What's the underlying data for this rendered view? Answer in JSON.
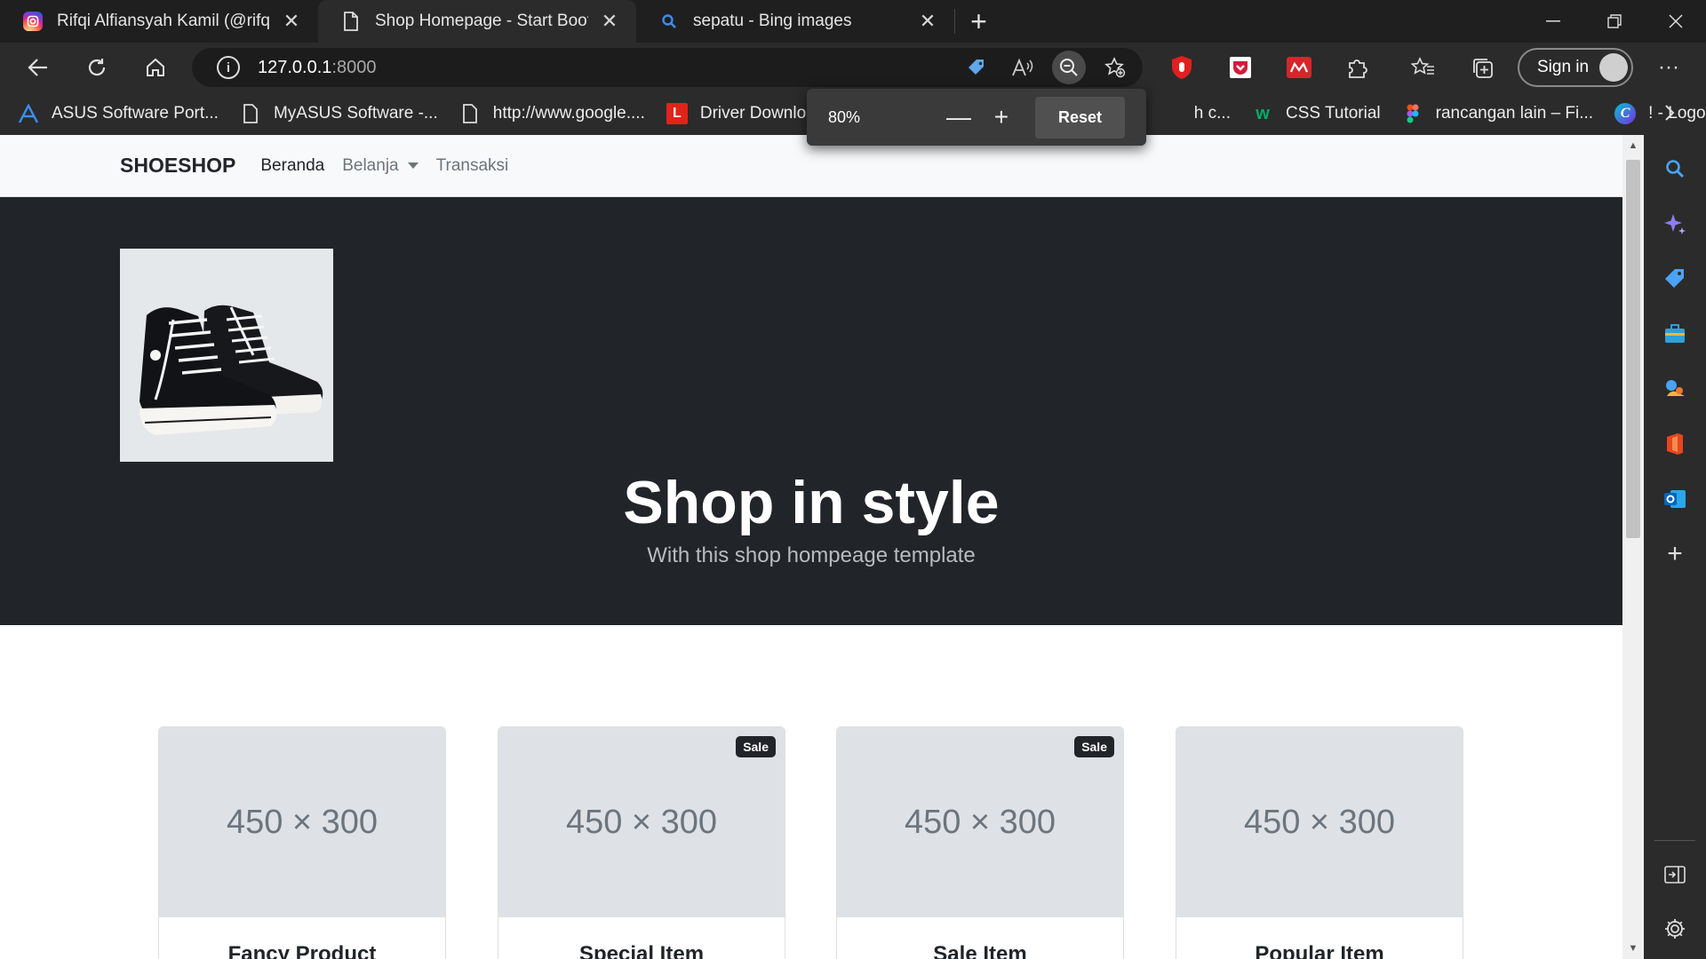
{
  "tabs": [
    {
      "title": "Rifqi Alfiansyah Kamil (@rifqii.ak",
      "close": "✕",
      "icon": "instagram-icon"
    },
    {
      "title": "Shop Homepage - Start Bootstra",
      "close": "✕",
      "icon": "page-icon"
    },
    {
      "title": "sepatu - Bing images",
      "close": "✕",
      "icon": "search-icon"
    }
  ],
  "address": {
    "host": "127.0.0.1",
    "port": ":8000"
  },
  "signin_label": "Sign in",
  "bookmarks": [
    {
      "label": "ASUS Software Port...",
      "icon": "asus-icon"
    },
    {
      "label": "MyASUS Software -...",
      "icon": "page-icon"
    },
    {
      "label": "http://www.google....",
      "icon": "page-icon"
    },
    {
      "label": "Driver Downloads",
      "icon": "lenovo-icon"
    },
    {
      "label": "h c...",
      "icon": ""
    },
    {
      "label": "CSS Tutorial",
      "icon": "w3schools-icon"
    },
    {
      "label": "rancangan lain – Fi...",
      "icon": "figma-icon"
    },
    {
      "label": "! - Logo",
      "icon": "canva-icon"
    }
  ],
  "zoom": {
    "percent": "80%",
    "minus": "—",
    "plus": "+",
    "reset": "Reset"
  },
  "navbar": {
    "brand": "SHOESHOP",
    "links": [
      "Beranda",
      "Belanja",
      "Transaksi"
    ]
  },
  "hero": {
    "title": "Shop in style",
    "subtitle": "With this shop hompeage template"
  },
  "products": [
    {
      "placeholder": "450 × 300",
      "name": "Fancy Product",
      "badge": ""
    },
    {
      "placeholder": "450 × 300",
      "name": "Special Item",
      "badge": "Sale"
    },
    {
      "placeholder": "450 × 300",
      "name": "Sale Item",
      "badge": "Sale"
    },
    {
      "placeholder": "450 × 300",
      "name": "Popular Item",
      "badge": ""
    }
  ],
  "colors": {
    "hero_bg": "#212529",
    "navbar_bg": "#f8f9fa",
    "placeholder_bg": "#dee2e6"
  }
}
